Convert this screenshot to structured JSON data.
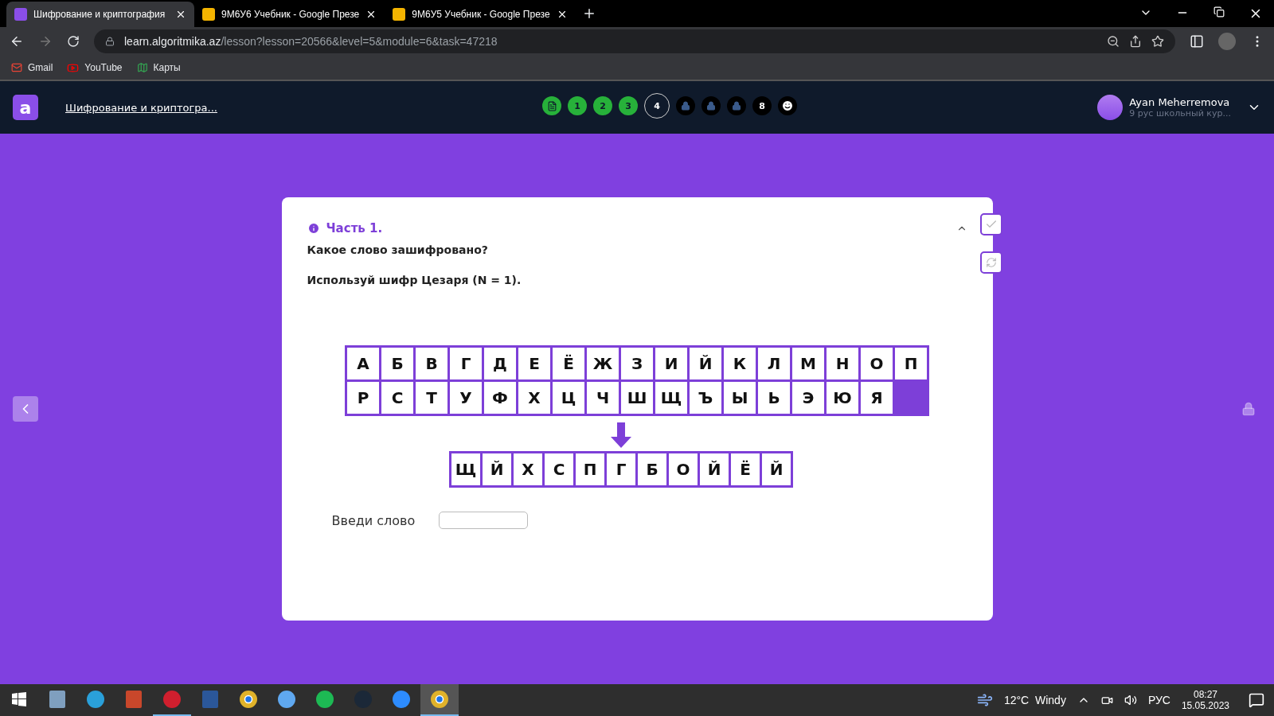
{
  "browser": {
    "tabs": [
      {
        "title": "Шифрование и криптография",
        "selected": true
      },
      {
        "title": "9М6У6 Учебник - Google Презе",
        "selected": false
      },
      {
        "title": "9М6У5 Учебник - Google Презе",
        "selected": false
      }
    ],
    "url_host": "learn.algoritmika.az",
    "url_path": "/lesson?lesson=20566&level=5&module=6&task=47218",
    "bookmarks": [
      {
        "label": "Gmail"
      },
      {
        "label": "YouTube"
      },
      {
        "label": "Карты"
      }
    ]
  },
  "header": {
    "logo": "a",
    "course_title": "Шифрование и криптогра...",
    "steps": [
      {
        "kind": "theory"
      },
      {
        "kind": "done",
        "label": "1"
      },
      {
        "kind": "done",
        "label": "2"
      },
      {
        "kind": "done",
        "label": "3"
      },
      {
        "kind": "current",
        "label": "4"
      },
      {
        "kind": "locked"
      },
      {
        "kind": "locked"
      },
      {
        "kind": "locked"
      },
      {
        "kind": "open",
        "label": "8"
      },
      {
        "kind": "final"
      }
    ],
    "user": {
      "name": "Ayan Meherremova",
      "group": "9 рус школьный кур..."
    }
  },
  "task": {
    "part": "Часть 1.",
    "expanded": true,
    "question": "Какое слово зашифровано?",
    "hint": "Используй шифр Цезаря (N = 1).",
    "alphabet_rows": [
      [
        "А",
        "Б",
        "В",
        "Г",
        "Д",
        "Е",
        "Ё",
        "Ж",
        "З",
        "И",
        "Й",
        "К",
        "Л",
        "М",
        "Н",
        "О",
        "П"
      ],
      [
        "Р",
        "С",
        "Т",
        "У",
        "Ф",
        "Х",
        "Ц",
        "Ч",
        "Ш",
        "Щ",
        "Ъ",
        "Ы",
        "Ь",
        "Э",
        "Ю",
        "Я"
      ]
    ],
    "cipher": [
      "Щ",
      "Й",
      "Х",
      "С",
      "П",
      "Г",
      "Б",
      "О",
      "Й",
      "Ё",
      "Й"
    ],
    "answer_label": "Введи слово"
  },
  "taskbar": {
    "apps": [
      {
        "kind": "calculator",
        "running": false,
        "selected": false
      },
      {
        "kind": "edge",
        "running": false,
        "selected": false
      },
      {
        "kind": "powerpoint",
        "running": false,
        "selected": false
      },
      {
        "kind": "opera",
        "running": true,
        "selected": false
      },
      {
        "kind": "word",
        "running": false,
        "selected": false
      },
      {
        "kind": "chrome",
        "running": false,
        "selected": false
      },
      {
        "kind": "gamebar",
        "running": false,
        "selected": false
      },
      {
        "kind": "spotify",
        "running": false,
        "selected": false
      },
      {
        "kind": "steam",
        "running": false,
        "selected": false
      },
      {
        "kind": "zoom",
        "running": false,
        "selected": false
      },
      {
        "kind": "chrome",
        "running": true,
        "selected": true
      }
    ],
    "weather": "12°C  Windy",
    "language": "РУС",
    "time": "08:27",
    "date": "15.05.2023"
  }
}
